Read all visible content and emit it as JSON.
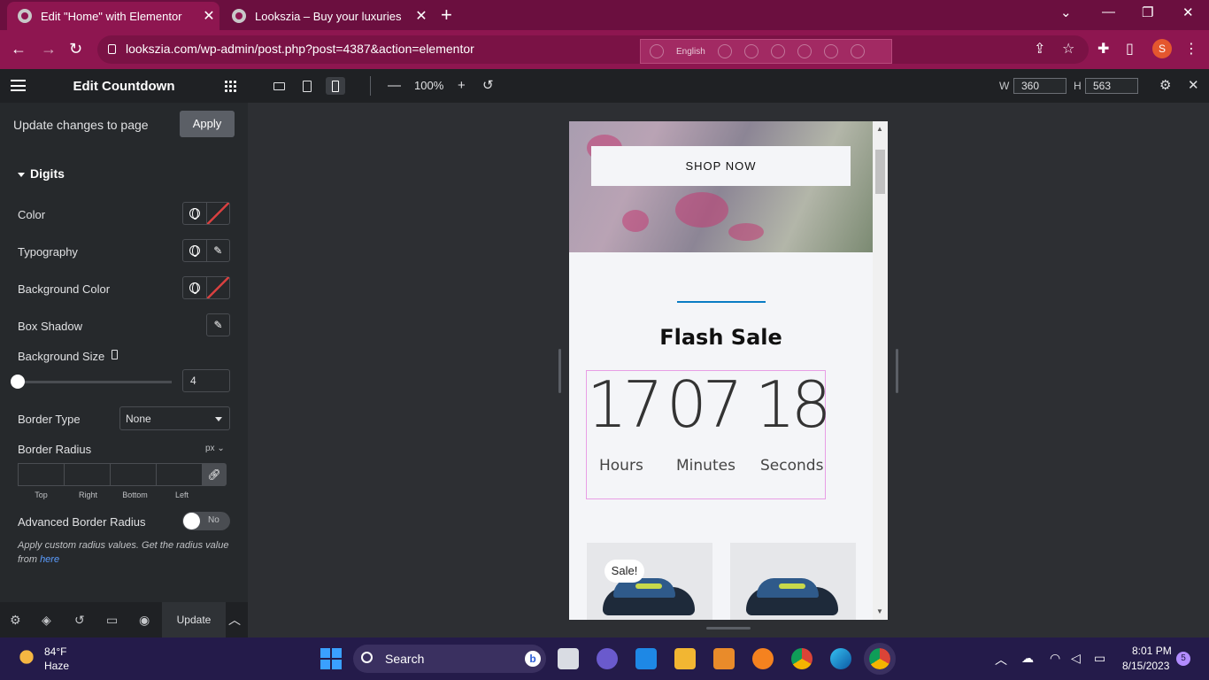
{
  "browser": {
    "tabs": [
      {
        "title": "Edit \"Home\" with Elementor",
        "active": true
      },
      {
        "title": "Lookszia – Buy your luxuries",
        "active": false
      }
    ],
    "url": "lookszia.com/wp-admin/post.php?post=4387&action=elementor",
    "language": "English",
    "profile_initial": "S"
  },
  "sidebar": {
    "title": "Edit Countdown",
    "apply_label": "Update changes to page",
    "apply_button": "Apply",
    "section": "Digits",
    "controls": {
      "color": "Color",
      "typography": "Typography",
      "background_color": "Background Color",
      "box_shadow": "Box Shadow",
      "background_size": "Background Size",
      "background_size_value": "4",
      "border_type": "Border Type",
      "border_type_value": "None",
      "border_radius": "Border Radius",
      "border_radius_unit": "px",
      "radius_labels": [
        "Top",
        "Right",
        "Bottom",
        "Left"
      ],
      "advanced_border_radius": "Advanced Border Radius",
      "toggle_state": "No",
      "help_text": "Apply custom radius values. Get the radius value from",
      "help_link": "here"
    },
    "footer": {
      "update_button": "Update"
    }
  },
  "toolbar": {
    "zoom": "100%",
    "width_label": "W",
    "width_value": "360",
    "height_label": "H",
    "height_value": "563"
  },
  "preview": {
    "shop_button": "SHOP NOW",
    "flash_title": "Flash Sale",
    "countdown": [
      {
        "value": "17",
        "label": "Hours"
      },
      {
        "value": "07",
        "label": "Minutes"
      },
      {
        "value": "18",
        "label": "Seconds"
      }
    ],
    "sale_badge": "Sale!"
  },
  "taskbar": {
    "temperature": "84°F",
    "weather": "Haze",
    "search_label": "Search",
    "time": "8:01 PM",
    "date": "8/15/2023",
    "notification_count": "5"
  }
}
